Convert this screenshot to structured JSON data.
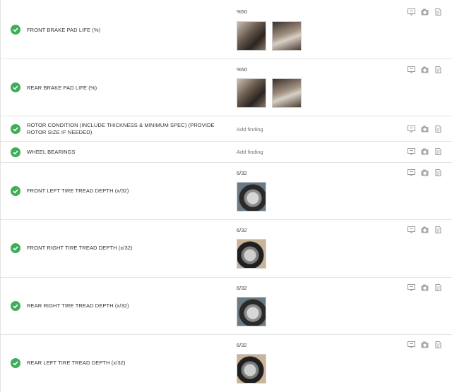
{
  "colors": {
    "check": "#3fae5a",
    "icon": "#9a9a9a",
    "divider": "#e4e4e4"
  },
  "icons": {
    "status": "check-circle-icon",
    "actions": [
      "comment-icon",
      "camera-icon",
      "note-icon"
    ]
  },
  "items": [
    {
      "label": "FRONT BRAKE PAD LIFE (%)",
      "finding": "%50",
      "photos": 2
    },
    {
      "label": "REAR BRAKE PAD LIFE (%)",
      "finding": "%50",
      "photos": 2
    },
    {
      "label": "ROTOR CONDITION (INCLUDE THICKNESS & MINIMUM SPEC) (PROVIDE ROTOR SIZE IF NEEDED)",
      "finding": "Add finding",
      "photos": 0
    },
    {
      "label": "WHEEL BEARINGS",
      "finding": "Add finding",
      "photos": 0
    },
    {
      "label": "FRONT LEFT TIRE TREAD DEPTH (x/32)",
      "finding": "6/32",
      "photos": 1
    },
    {
      "label": "FRONT RIGHT TIRE TREAD DEPTH (x/32)",
      "finding": "6/32",
      "photos": 1
    },
    {
      "label": "REAR RIGHT TIRE TREAD DEPTH (x/32)",
      "finding": "6/32",
      "photos": 1
    },
    {
      "label": "REAR LEFT TIRE TREAD DEPTH (x/32)",
      "finding": "6/32",
      "photos": 1
    }
  ]
}
